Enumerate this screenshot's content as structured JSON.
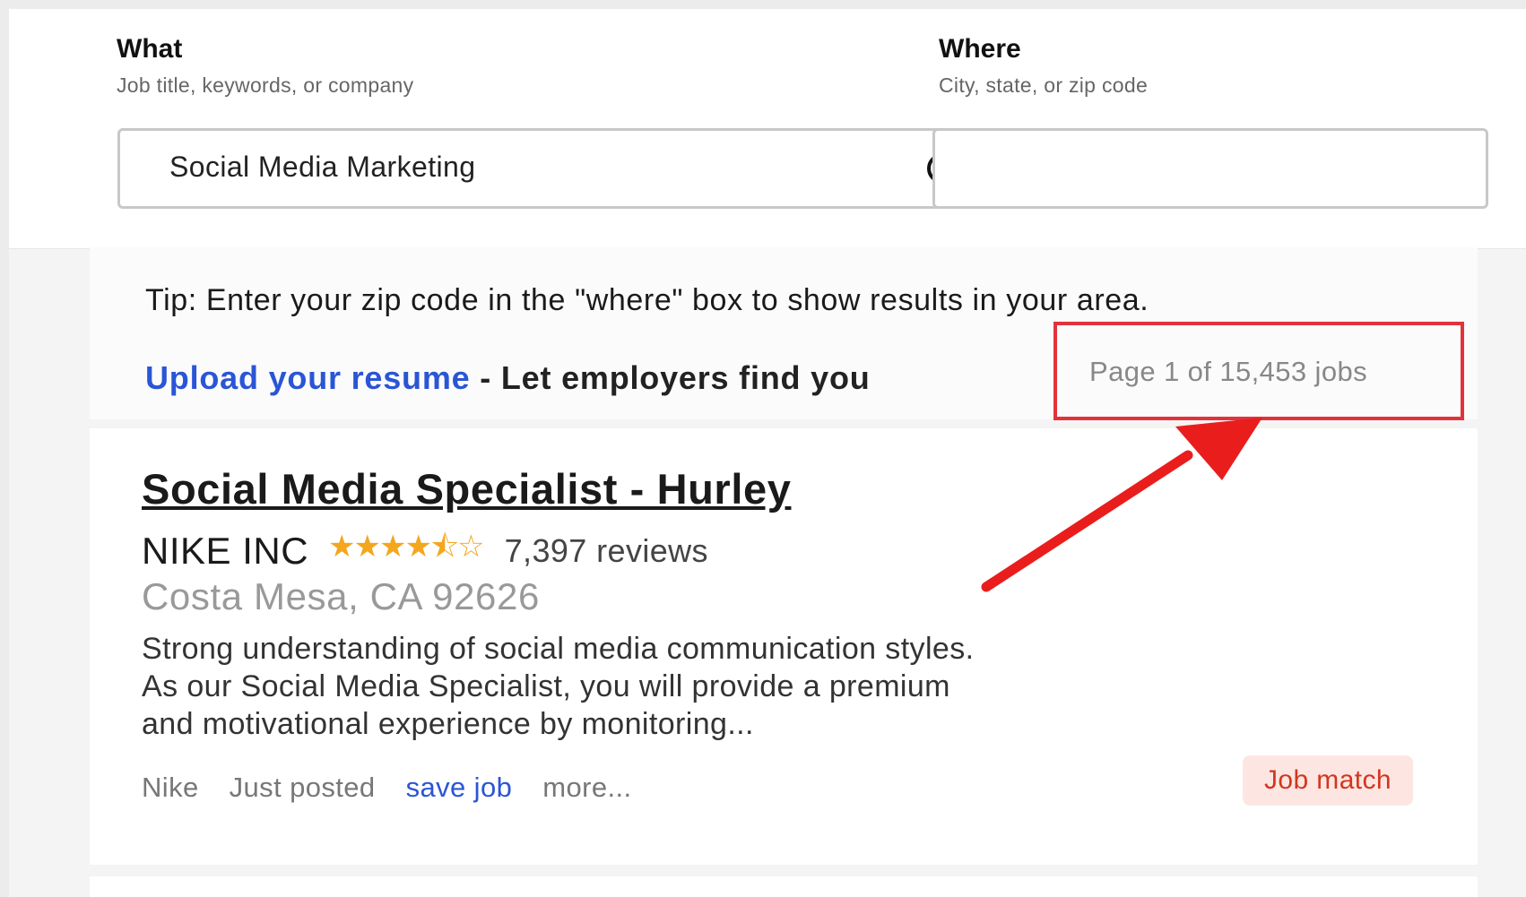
{
  "search": {
    "what": {
      "title": "What",
      "subtitle": "Job title, keywords, or company",
      "value": "Social Media Marketing"
    },
    "where": {
      "title": "Where",
      "subtitle": "City, state, or zip code",
      "value": ""
    }
  },
  "results": {
    "tip": "Tip: Enter your zip code in the \"where\" box to show results in your area.",
    "upload_link": "Upload your resume",
    "upload_suffix": " - Let employers find you",
    "count": "Page 1 of 15,453 jobs"
  },
  "job": {
    "title": "Social Media Specialist - Hurley",
    "company": "NIKE INC",
    "rating": 4.5,
    "stars_glyph": "★★★★⯪☆",
    "reviews": "7,397 reviews",
    "location": "Costa Mesa, CA 92626",
    "snippet": [
      "Strong understanding of social media communication styles.",
      "As our Social Media Specialist, you will provide a premium",
      "and motivational experience by monitoring..."
    ],
    "footer": {
      "source": "Nike",
      "posted": "Just posted",
      "save": "save job",
      "more": "more..."
    },
    "match_badge": "Job match"
  },
  "colors": {
    "link": "#2a55d6",
    "highlight": "#e2323a",
    "star": "#f4a61c",
    "badge_bg": "#fde6e2",
    "badge_text": "#d2361f"
  }
}
